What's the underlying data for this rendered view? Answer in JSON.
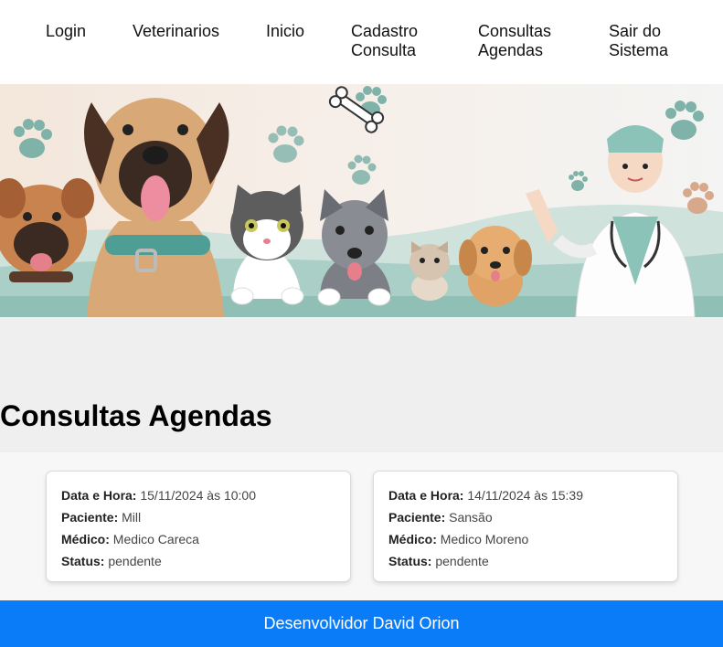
{
  "nav": {
    "items": [
      {
        "label": "Login"
      },
      {
        "label": "Veterinarios"
      },
      {
        "label": "Inicio"
      },
      {
        "label": "Cadastro Consulta"
      },
      {
        "label": "Consultas Agendas"
      },
      {
        "label": "Sair do Sistema"
      }
    ]
  },
  "page": {
    "title": "Consultas Agendas"
  },
  "consultas": [
    {
      "datahora_label": "Data e Hora:",
      "datahora": "15/11/2024 às 10:00",
      "paciente_label": "Paciente:",
      "paciente": "Mill",
      "medico_label": "Médico:",
      "medico": "Medico Careca",
      "status_label": "Status:",
      "status": "pendente"
    },
    {
      "datahora_label": "Data e Hora:",
      "datahora": "14/11/2024 às 15:39",
      "paciente_label": "Paciente:",
      "paciente": "Sansão",
      "medico_label": "Médico:",
      "medico": "Medico Moreno",
      "status_label": "Status:",
      "status": "pendente"
    }
  ],
  "footer": {
    "text": "Desenvolvidor David Orion"
  },
  "colors": {
    "footer_bg": "#0a7cf7",
    "accent_teal": "#8fbfb5"
  }
}
